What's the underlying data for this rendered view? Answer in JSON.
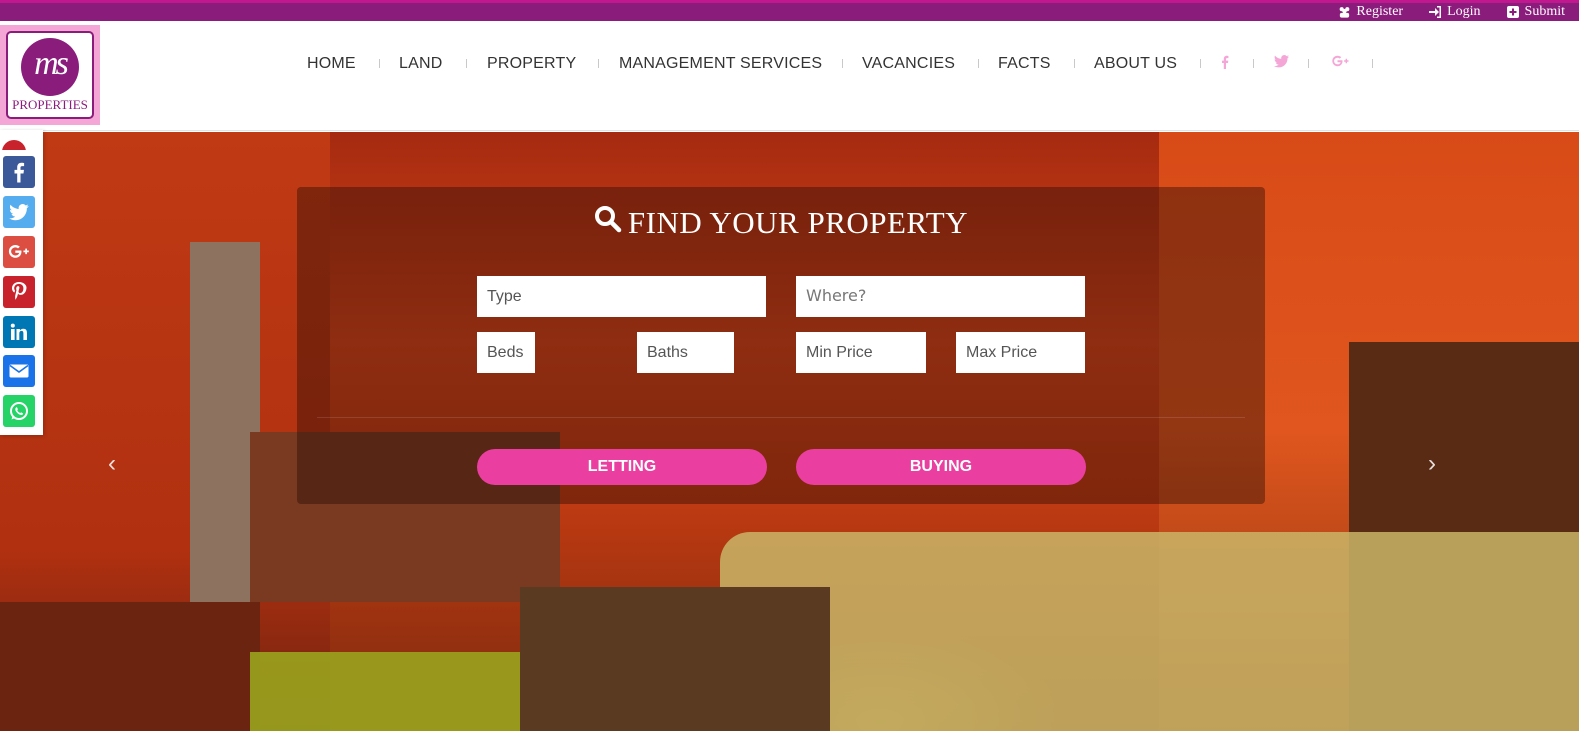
{
  "topbar": {
    "links": [
      {
        "label": "Register",
        "icon": "users-icon"
      },
      {
        "label": "Login",
        "icon": "sign-in-icon"
      },
      {
        "label": "Submit",
        "icon": "plus-square-icon"
      }
    ]
  },
  "logo": {
    "mark": "ms",
    "text": "PROPERTIES"
  },
  "nav": {
    "items": [
      "HOME",
      "LAND",
      "PROPERTY",
      "MANAGEMENT SERVICES",
      "VACANCIES",
      "FACTS",
      "ABOUT US"
    ],
    "social": [
      "facebook-icon",
      "twitter-icon",
      "google-plus-icon"
    ]
  },
  "search": {
    "title": "FIND YOUR PROPERTY",
    "type_placeholder": "Type",
    "where_placeholder": "Where?",
    "beds_placeholder": "Beds",
    "baths_placeholder": "Baths",
    "min_price_placeholder": "Min Price",
    "max_price_placeholder": "Max Price",
    "letting_label": "LETTING",
    "buying_label": "BUYING"
  },
  "carousel": {
    "prev": "‹",
    "next": "›"
  },
  "share": [
    "facebook",
    "twitter",
    "google-plus",
    "pinterest",
    "linkedin",
    "email",
    "whatsapp"
  ],
  "colors": {
    "brand_purple": "#8a1c7c",
    "accent_pink": "#ea3fa0",
    "logo_bg": "#f4a7d7"
  }
}
